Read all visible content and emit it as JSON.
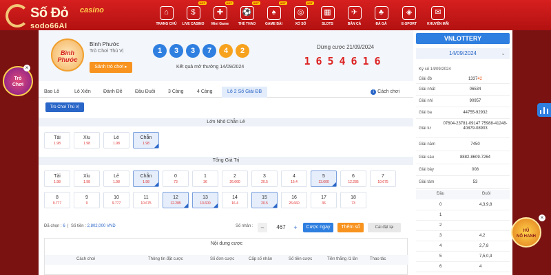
{
  "brand": {
    "line1": "Số Đỏ",
    "line1b": "casino",
    "line2": "sodo66AI"
  },
  "nav": [
    {
      "label": "TRANG CHỦ",
      "icon": "home-icon",
      "glyph": "⌂",
      "hot": ""
    },
    {
      "label": "LIVE CASINO",
      "icon": "chip-icon",
      "glyph": "$",
      "hot": "HOT"
    },
    {
      "label": "Mini Game",
      "icon": "gamepad-icon",
      "glyph": "✚",
      "hot": "HOT"
    },
    {
      "label": "THỂ THAO",
      "icon": "ball-icon",
      "glyph": "⚽",
      "hot": "HOT"
    },
    {
      "label": "GAME BÀI",
      "icon": "cards-icon",
      "glyph": "♠",
      "hot": "HOT"
    },
    {
      "label": "XỔ SỐ",
      "icon": "lottery-icon",
      "glyph": "◎",
      "hot": "HOT"
    },
    {
      "label": "SLOTS",
      "icon": "slot-icon",
      "glyph": "▦",
      "hot": ""
    },
    {
      "label": "BẮN CÁ",
      "icon": "fish-icon",
      "glyph": "✈",
      "hot": ""
    },
    {
      "label": "ĐÁ GÀ",
      "icon": "rooster-icon",
      "glyph": "♣",
      "hot": ""
    },
    {
      "label": "E-SPORT",
      "icon": "controller-icon",
      "glyph": "◈",
      "hot": ""
    },
    {
      "label": "KHUYẾN MÃI",
      "icon": "gift-icon",
      "glyph": "✉",
      "hot": ""
    }
  ],
  "left_promo": {
    "line1": "Trò",
    "line2": "Chơi"
  },
  "right_promo": {
    "line1": "HŨ",
    "line2": "NỔ HANH"
  },
  "province": {
    "avatar_line1": "Bình",
    "avatar_line2": "Phước",
    "name": "Bình Phước",
    "subtitle": "Trò Chơi Thú Vị",
    "lobby_button": "Sảnh trò chơi ▸"
  },
  "draw": {
    "balls": [
      "1",
      "3",
      "3",
      "7",
      "4",
      "2"
    ],
    "ball_colors": [
      "blue",
      "blue",
      "blue",
      "blue",
      "orange",
      "orange"
    ],
    "result_text": "Kết quả mở thưởng 14/09/2024",
    "stop_text": "Dừng cược 21/09/2024",
    "timer": [
      "1",
      "6",
      "5",
      "4",
      "6",
      "1",
      "6"
    ]
  },
  "tabs": [
    {
      "label": "Bao Lô"
    },
    {
      "label": "Lô Xiên"
    },
    {
      "label": "Đánh Đề"
    },
    {
      "label": "Đầu Đuôi"
    },
    {
      "label": "3 Càng"
    },
    {
      "label": "4 Càng"
    },
    {
      "label": "Lô 2 Số Giải ĐB"
    }
  ],
  "rules_link": "Cách chơi",
  "mode_button": "Trò Chơi Thú Vị",
  "section1": {
    "title": "Lớn Nhỏ Chẵn Lẻ",
    "cells": [
      {
        "name": "Tài",
        "odds": "1.98",
        "selected": false
      },
      {
        "name": "Xỉu",
        "odds": "1.98",
        "selected": false
      },
      {
        "name": "Lẻ",
        "odds": "1.98",
        "selected": false
      },
      {
        "name": "Chẵn",
        "odds": "1.98",
        "selected": true
      }
    ]
  },
  "section2": {
    "title": "Tổng Giá Trị",
    "row1": [
      {
        "name": "Tài",
        "odds": "1.98",
        "selected": false
      },
      {
        "name": "Xỉu",
        "odds": "1.98",
        "selected": false
      },
      {
        "name": "Lẻ",
        "odds": "1.98",
        "selected": false
      },
      {
        "name": "Chẵn",
        "odds": "1.98",
        "selected": true
      },
      {
        "name": "0",
        "odds": "73",
        "selected": false
      },
      {
        "name": "1",
        "odds": "36",
        "selected": false
      },
      {
        "name": "2",
        "odds": "26.660",
        "selected": false
      },
      {
        "name": "3",
        "odds": "20.5",
        "selected": false
      },
      {
        "name": "4",
        "odds": "16.4",
        "selected": false
      },
      {
        "name": "5",
        "odds": "13.600",
        "selected": true
      },
      {
        "name": "6",
        "odds": "12.285",
        "selected": false
      },
      {
        "name": "7",
        "odds": "10.675",
        "selected": false
      }
    ],
    "row2": [
      {
        "name": "8",
        "odds": "9.777",
        "selected": false
      },
      {
        "name": "9",
        "odds": "9",
        "selected": false
      },
      {
        "name": "10",
        "odds": "9.777",
        "selected": false
      },
      {
        "name": "11",
        "odds": "10.675",
        "selected": false
      },
      {
        "name": "12",
        "odds": "12.285",
        "selected": true
      },
      {
        "name": "13",
        "odds": "13.600",
        "selected": true
      },
      {
        "name": "14",
        "odds": "16.4",
        "selected": false
      },
      {
        "name": "15",
        "odds": "20.5",
        "selected": true
      },
      {
        "name": "16",
        "odds": "26.660",
        "selected": false
      },
      {
        "name": "17",
        "odds": "36",
        "selected": false
      },
      {
        "name": "18",
        "odds": "73",
        "selected": false
      }
    ]
  },
  "footer": {
    "selected_label": "Đã chọn :",
    "selected_count": "6",
    "amount_label": "Số tiền :",
    "amount": "2,802,000 VND",
    "multiplier_label": "Số nhân :",
    "multiplier": "467",
    "minus": "−",
    "plus": "+",
    "quick_bet": "Cược ngay",
    "add_bet": "Thêm số",
    "reset": "Cài đặt lại"
  },
  "bet_table": {
    "title": "Nội dung cược",
    "columns": [
      "Cách chơi",
      "Thông tin đặt cược",
      "Số đơn cược",
      "Cấp số nhân",
      "Số tiền cược",
      "Tiền thắng /1 lần",
      "Thao tác"
    ]
  },
  "results": {
    "provider": "VNLOTTERY",
    "date": "14/09/2024",
    "draw_label": "Kỳ số 14/09/2024",
    "prizes": [
      {
        "label": "Giải đb",
        "value_main": "1337",
        "value_hl": "42"
      },
      {
        "label": "Giải nhất",
        "value_main": "06534",
        "value_hl": ""
      },
      {
        "label": "Giải nhì",
        "value_main": "90957",
        "value_hl": ""
      },
      {
        "label": "Giải ba",
        "value_main": "44755-92932",
        "value_hl": ""
      },
      {
        "label": "Giải tư",
        "value_main": "07604-23781-09147 75988-41248-40879-08903",
        "value_hl": ""
      },
      {
        "label": "Giải năm",
        "value_main": "7450",
        "value_hl": ""
      },
      {
        "label": "Giải sáu",
        "value_main": "8882-8609-7264",
        "value_hl": ""
      },
      {
        "label": "Giải bảy",
        "value_main": "008",
        "value_hl": ""
      },
      {
        "label": "Giải tám",
        "value_main": "53",
        "value_hl": ""
      }
    ],
    "loto_head": [
      "Đầu",
      "Đuôi"
    ],
    "loto_rows": [
      {
        "head": "0",
        "tail": "4,3,9,8"
      },
      {
        "head": "1",
        "tail": ""
      },
      {
        "head": "2",
        "tail": ""
      },
      {
        "head": "3",
        "tail": "4,2"
      },
      {
        "head": "4",
        "tail": "2,7,8"
      },
      {
        "head": "5",
        "tail": "7,5,0,3"
      },
      {
        "head": "6",
        "tail": "4"
      }
    ]
  }
}
